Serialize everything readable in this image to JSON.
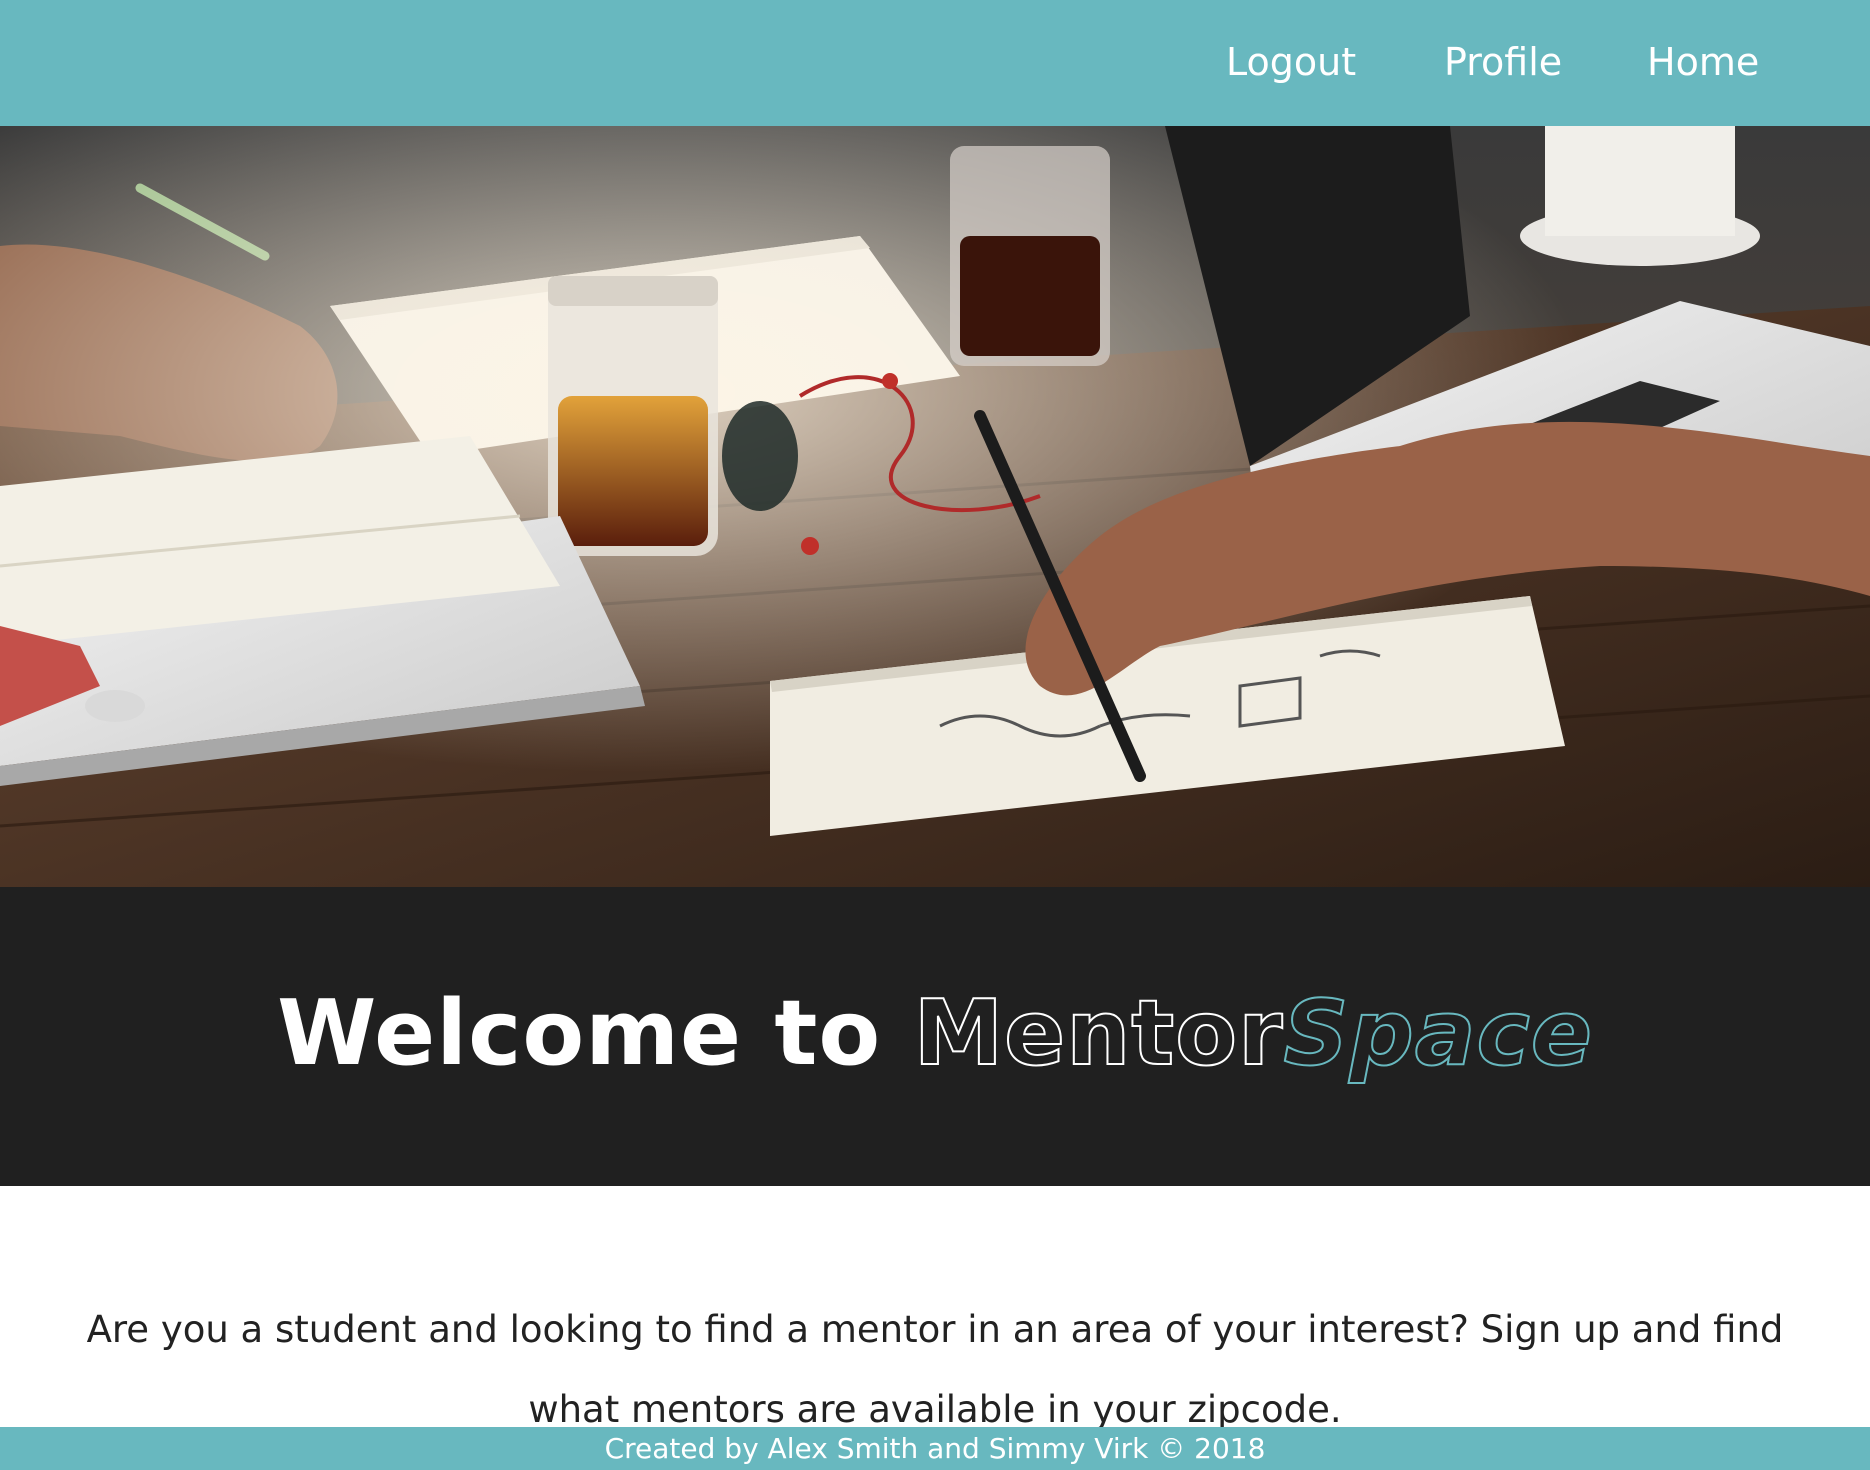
{
  "nav": {
    "links": [
      {
        "label": "Logout"
      },
      {
        "label": "Profile"
      },
      {
        "label": "Home"
      }
    ]
  },
  "hero": {
    "image_alt": "Students working at a wooden table with laptops, notebooks and drinks"
  },
  "welcome": {
    "prefix": "Welcome to ",
    "brand_part1": "Mentor",
    "brand_part2": "Space"
  },
  "intro": {
    "text": "Are you a student and looking to find a mentor in an area of your interest? Sign up and find what mentors are available in your zipcode."
  },
  "footer": {
    "text": "Created by Alex Smith and Simmy Virk © 2018"
  },
  "colors": {
    "accent": "#68b8bf",
    "dark_band": "#202020",
    "text": "#222222",
    "white": "#ffffff"
  }
}
